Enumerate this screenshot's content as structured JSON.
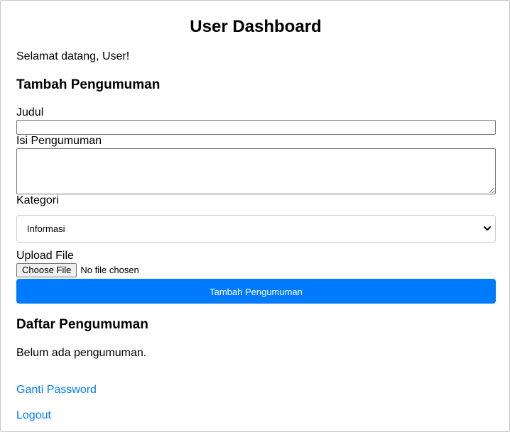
{
  "header": {
    "title": "User Dashboard",
    "welcome": "Selamat datang, User!"
  },
  "form": {
    "heading": "Tambah Pengumuman",
    "title_label": "Judul",
    "title_value": "",
    "content_label": "Isi Pengumuman",
    "content_value": "",
    "category_label": "Kategori",
    "category_selected": "Informasi",
    "upload_label": "Upload File",
    "choose_file_label": "Choose File",
    "file_status": "No file chosen",
    "submit_label": "Tambah Pengumuman"
  },
  "list": {
    "heading": "Daftar Pengumuman",
    "empty_text": "Belum ada pengumuman."
  },
  "links": {
    "change_password": "Ganti Password",
    "logout": "Logout"
  },
  "colors": {
    "accent": "#007bff",
    "background": "#ffffff"
  },
  "icons": {
    "select_arrow": "chevron-down-icon"
  }
}
